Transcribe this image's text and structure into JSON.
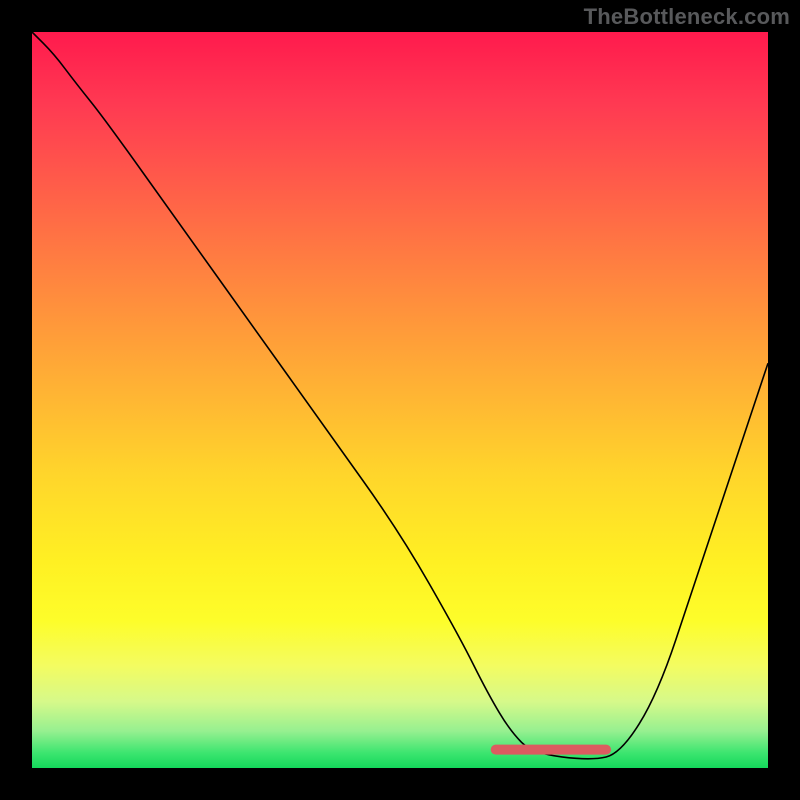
{
  "attribution": "TheBottleneck.com",
  "colors": {
    "flat_segment": "#db5c60"
  },
  "chart_data": {
    "type": "line",
    "title": "",
    "xlabel": "",
    "ylabel": "",
    "xlim": [
      0,
      100
    ],
    "ylim": [
      0,
      100
    ],
    "grid": false,
    "legend": false,
    "series": [
      {
        "name": "curve",
        "x": [
          0,
          3,
          6,
          10,
          20,
          30,
          40,
          50,
          58,
          62,
          65,
          68,
          76,
          80,
          85,
          90,
          95,
          100
        ],
        "y": [
          100,
          97,
          93,
          88,
          74,
          60,
          46,
          32,
          18,
          10,
          5,
          2,
          1,
          2,
          10,
          25,
          40,
          55
        ]
      }
    ],
    "flat_segment": {
      "x_start": 63,
      "x_end": 78,
      "y": 2.5
    }
  }
}
